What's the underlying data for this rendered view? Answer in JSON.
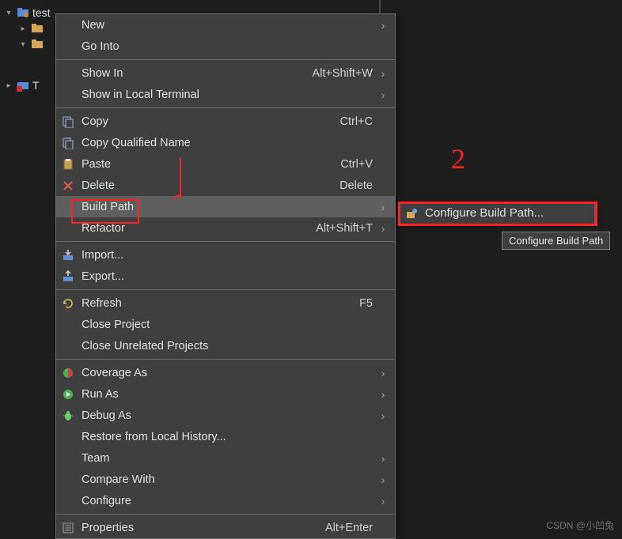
{
  "tree": {
    "project": "test",
    "node1": "",
    "node2": "",
    "node3": "T"
  },
  "menu": {
    "new": "New",
    "go_into": "Go Into",
    "show_in": "Show In",
    "show_in_sc": "Alt+Shift+W",
    "show_local_term": "Show in Local Terminal",
    "copy": "Copy",
    "copy_sc": "Ctrl+C",
    "copy_qn": "Copy Qualified Name",
    "paste": "Paste",
    "paste_sc": "Ctrl+V",
    "delete": "Delete",
    "delete_sc": "Delete",
    "build_path": "Build Path",
    "refactor": "Refactor",
    "refactor_sc": "Alt+Shift+T",
    "import": "Import...",
    "export": "Export...",
    "refresh": "Refresh",
    "refresh_sc": "F5",
    "close_proj": "Close Project",
    "close_unrel": "Close Unrelated Projects",
    "coverage": "Coverage As",
    "run_as": "Run As",
    "debug_as": "Debug As",
    "restore": "Restore from Local History...",
    "team": "Team",
    "compare": "Compare With",
    "configure": "Configure",
    "properties": "Properties",
    "properties_sc": "Alt+Enter",
    "arrow": "›"
  },
  "submenu": {
    "configure_bp": "Configure Build Path..."
  },
  "tooltip": "Configure Build Path",
  "watermark": "CSDN @小凹兔",
  "annotations": {
    "one": "1",
    "two": "2"
  }
}
